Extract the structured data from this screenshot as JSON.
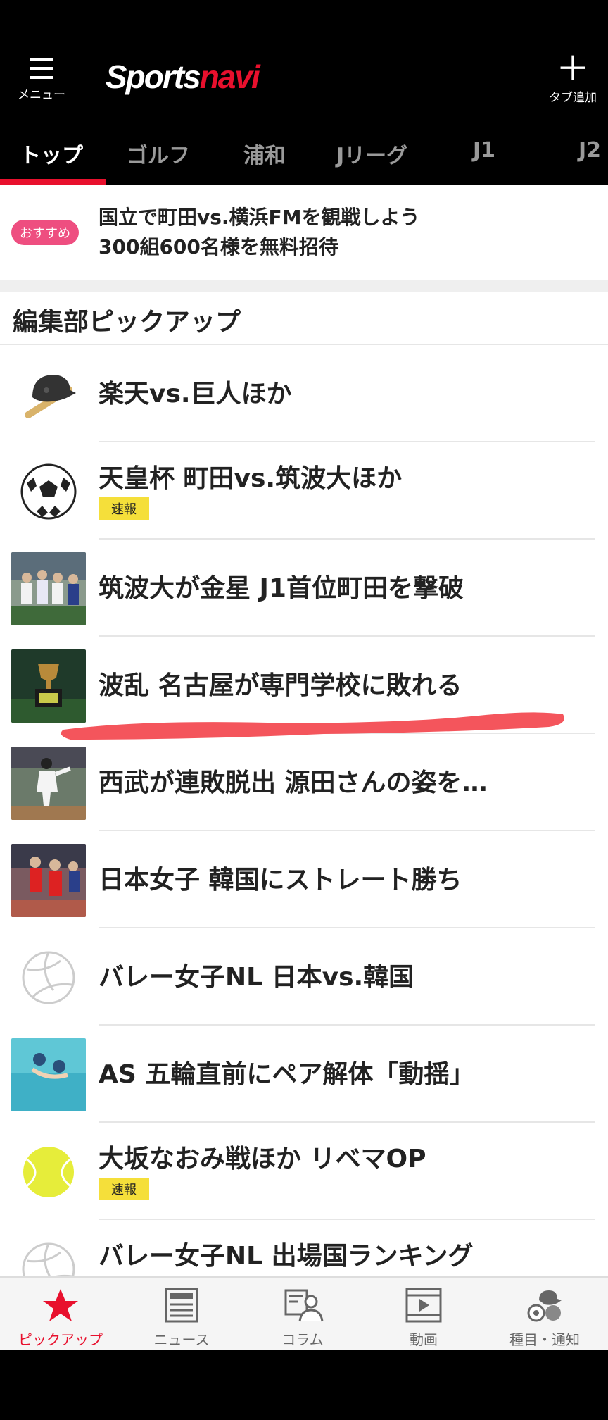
{
  "header": {
    "menu_label": "メニュー",
    "logo_white": "Sports",
    "logo_red": "navi",
    "tab_add_label": "タブ追加"
  },
  "tabs": [
    {
      "label": "トップ",
      "active": true
    },
    {
      "label": "ゴルフ"
    },
    {
      "label": "浦和"
    },
    {
      "label": "Jリーグ"
    },
    {
      "label": "J1"
    },
    {
      "label": "J2"
    }
  ],
  "promo": {
    "badge": "おすすめ",
    "line1": "国立で町田vs.横浜FMを観戦しよう",
    "line2": "300組600名様を無料招待"
  },
  "section": {
    "title": "編集部ピックアップ"
  },
  "items": [
    {
      "title": "楽天vs.巨人ほか",
      "icon": "baseball-helmet-bat-icon"
    },
    {
      "title": "天皇杯 町田vs.筑波大ほか",
      "badge": "速報",
      "icon": "soccer-ball-icon"
    },
    {
      "title": "筑波大が金星 J1首位町田を撃破",
      "icon": "soccer-team-photo"
    },
    {
      "title": "波乱 名古屋が専門学校に敗れる",
      "icon": "trophy-photo"
    },
    {
      "title": "西武が連敗脱出 源田さんの姿を…",
      "icon": "baseball-pitcher-photo"
    },
    {
      "title": "日本女子 韓国にストレート勝ち",
      "icon": "volleyball-player-photo"
    },
    {
      "title": "バレー女子NL 日本vs.韓国",
      "icon": "volleyball-icon"
    },
    {
      "title": "AS 五輪直前にペア解体「動揺」",
      "icon": "artistic-swimming-photo"
    },
    {
      "title": "大坂なおみ戦ほか リベマOP",
      "badge": "速報",
      "icon": "tennis-ball-icon"
    },
    {
      "title": "バレー女子NL 出場国ランキング",
      "icon": "volleyball-icon"
    }
  ],
  "bottom_nav": [
    {
      "label": "ピックアップ",
      "icon": "star-icon",
      "active": true
    },
    {
      "label": "ニュース",
      "icon": "newspaper-icon"
    },
    {
      "label": "コラム",
      "icon": "column-person-icon"
    },
    {
      "label": "動画",
      "icon": "film-icon"
    },
    {
      "label": "種目・通知",
      "icon": "sports-balls-icon"
    }
  ],
  "colors": {
    "accent": "#e8102d",
    "badge_pink": "#ee4e80",
    "flash_yellow": "#f5df3a",
    "annotation_stroke": "#f4555c"
  }
}
